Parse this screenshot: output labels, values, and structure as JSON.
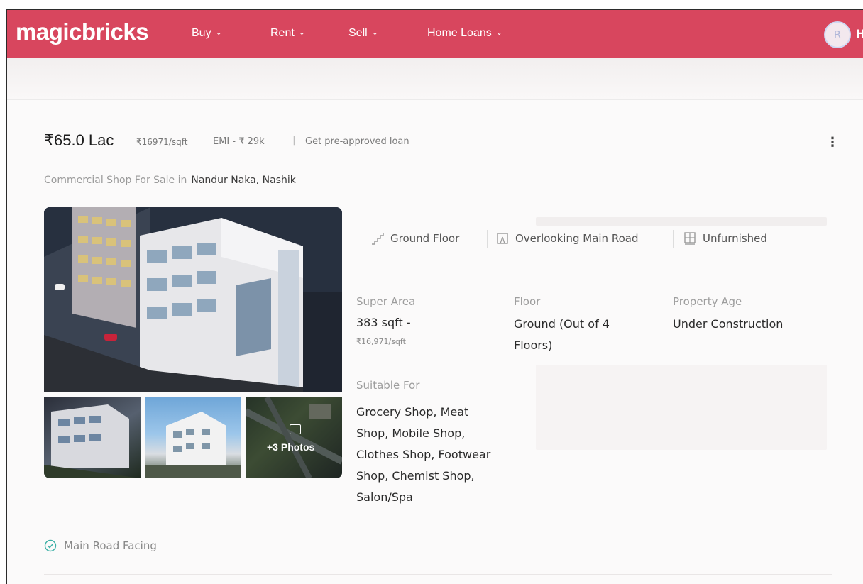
{
  "header": {
    "logo": "magicbricks",
    "nav": [
      {
        "label": "Buy"
      },
      {
        "label": "Rent"
      },
      {
        "label": "Sell"
      },
      {
        "label": "Home Loans"
      }
    ],
    "avatar_initial": "R",
    "user_label": "H"
  },
  "listing": {
    "price": "₹65.0 Lac",
    "rate": "₹16971/sqft",
    "emi": "EMI - ₹ 29k",
    "loan_link": "Get pre-approved loan",
    "title_prefix": "Commercial Shop For Sale in",
    "locality": "Nandur Naka, Nashik",
    "more_photos": "+3 Photos",
    "highlights": [
      "Ground Floor",
      "Overlooking Main Road",
      "Unfurnished"
    ],
    "super_area_label": "Super Area",
    "super_area_value": "383 sqft -",
    "super_area_rate": "₹16,971/sqft",
    "floor_label": "Floor",
    "floor_value": "Ground (Out of 4 Floors)",
    "age_label": "Property Age",
    "age_value": "Under Construction",
    "suitable_label": "Suitable For",
    "suitable_value": "Grocery Shop, Meat Shop, Mobile Shop, Clothes Shop, Footwear Shop, Chemist Shop, Salon/Spa",
    "feature": "Main Road Facing"
  },
  "colors": {
    "brand": "#d8465e",
    "feature_check": "#3cb0a6"
  },
  "icons": [
    "chevron-down-icon",
    "kebab-menu-icon",
    "staircase-icon",
    "road-view-icon",
    "furniture-icon",
    "gallery-icon",
    "check-circle-icon"
  ]
}
